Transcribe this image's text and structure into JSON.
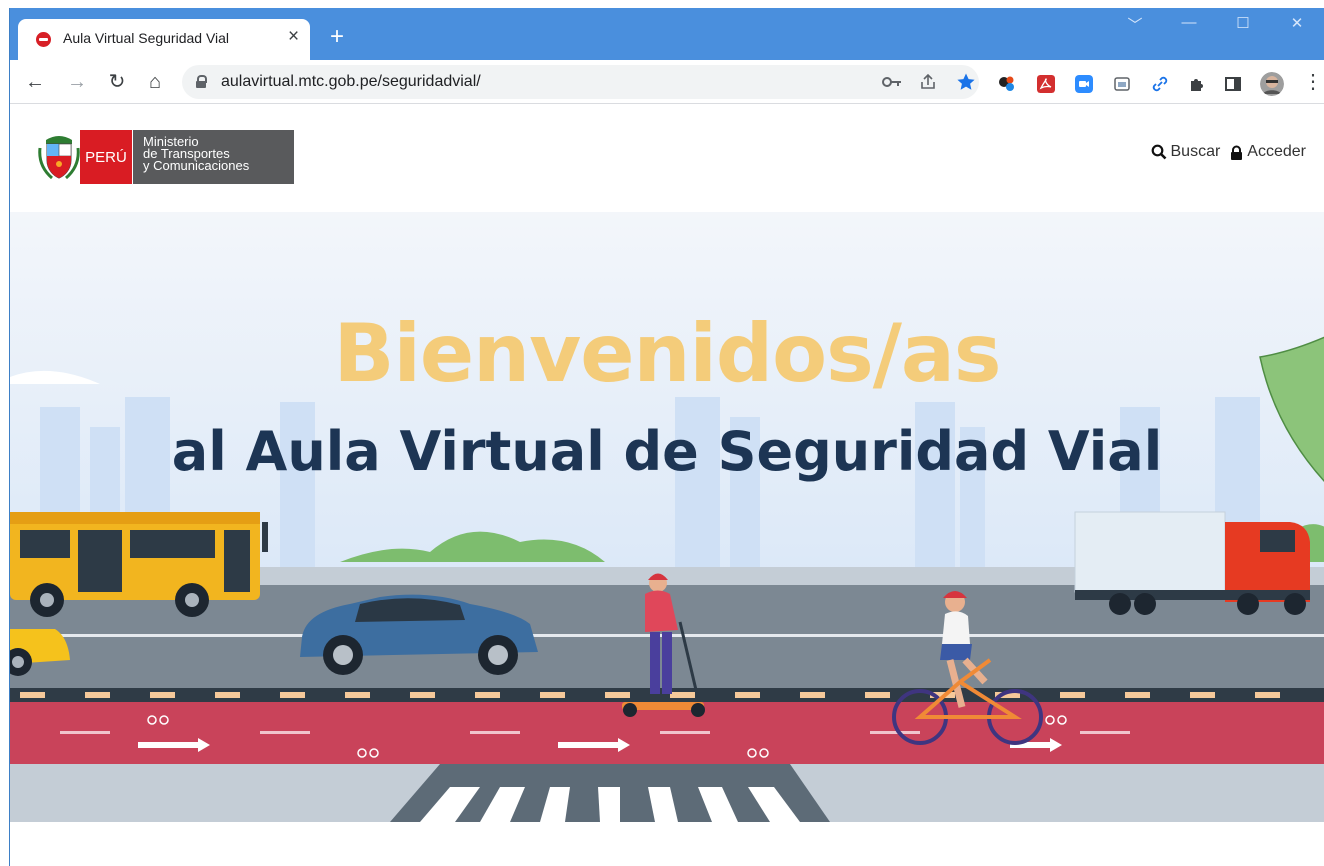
{
  "browser": {
    "tab_title": "Aula Virtual Seguridad Vial",
    "tab_close": "×",
    "new_tab": "+",
    "url": "aulavirtual.mtc.gob.pe/seguridadvial/",
    "win_controls": [
      "﹀",
      "—",
      "☐",
      "✕"
    ],
    "nav": {
      "back": "←",
      "forward": "→",
      "reload": "↻",
      "home": "⌂"
    },
    "menu": "⋮"
  },
  "site": {
    "logo": {
      "country": "PERÚ",
      "ministry_lines": [
        "Ministerio",
        "de Transportes",
        "y Comunicaciones"
      ]
    },
    "header_links": {
      "search": "Buscar",
      "login": "Acceder"
    }
  },
  "hero": {
    "title": "Bienvenidos/as",
    "subtitle": "al Aula Virtual de Seguridad Vial"
  },
  "colors": {
    "titlebar": "#4a8fdd",
    "hero_title": "#f4cc7a",
    "hero_subtitle": "#1d3554",
    "bike_lane": "#c9435a",
    "peru_red": "#d91c23"
  }
}
